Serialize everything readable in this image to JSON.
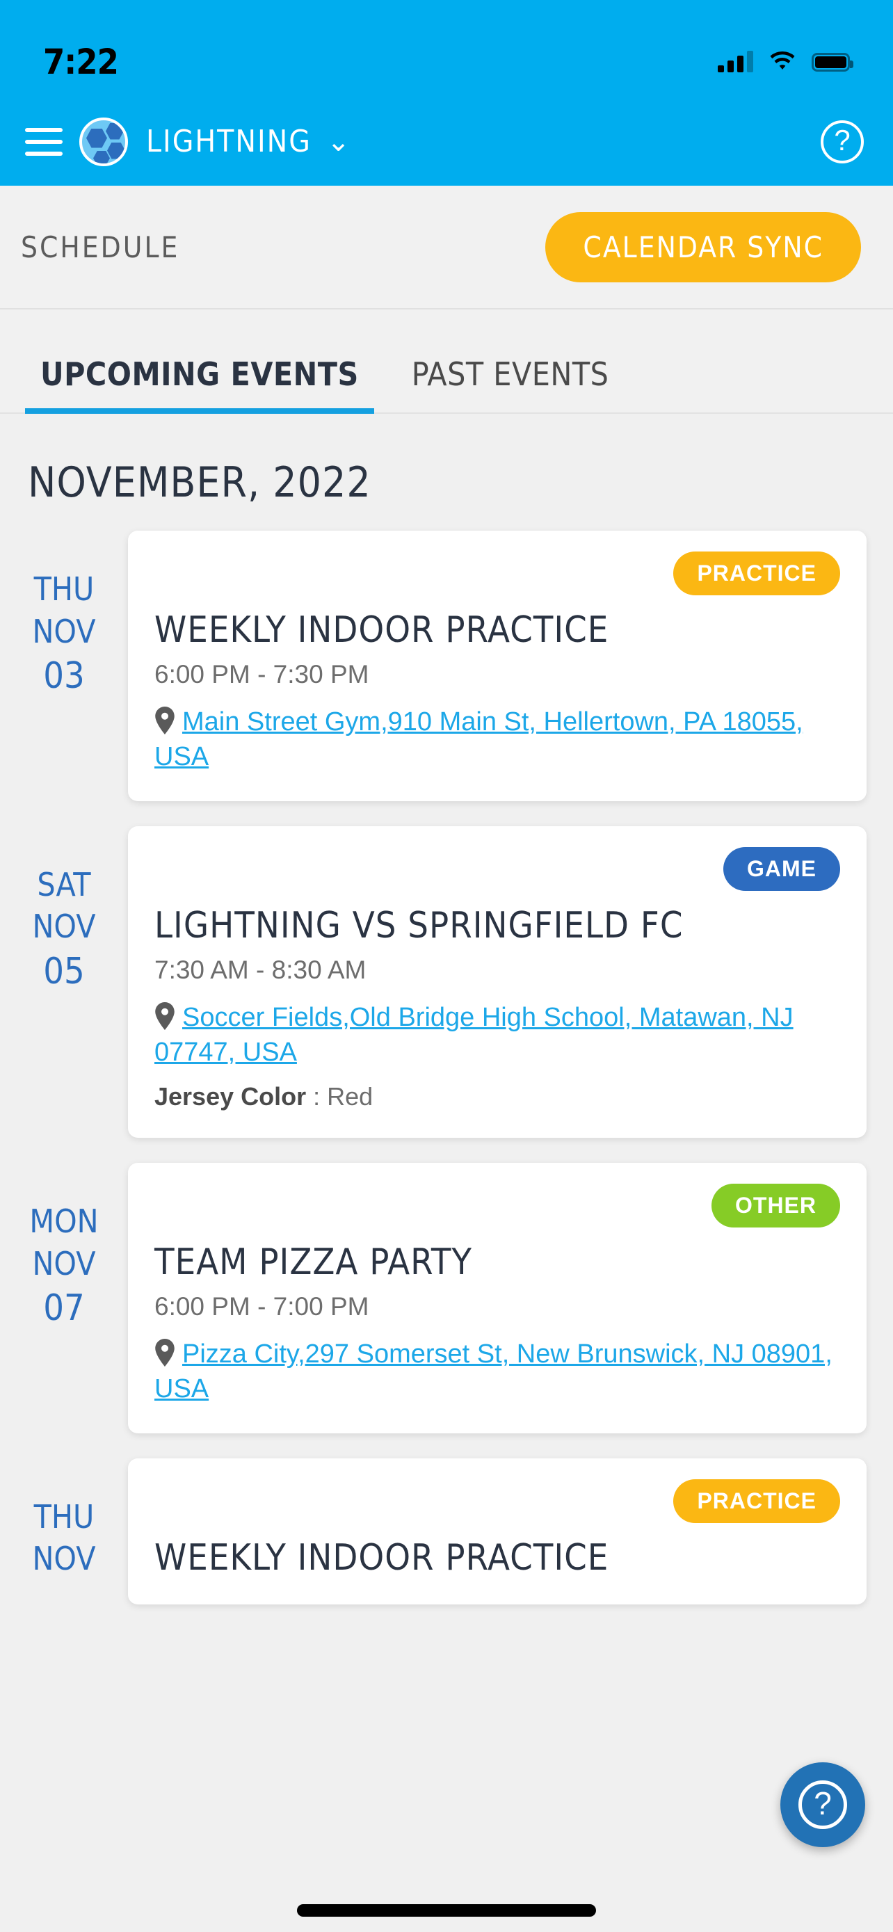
{
  "status_bar": {
    "time": "7:22",
    "signal_icon": "cellular-signal-icon",
    "wifi_icon": "wifi-icon",
    "battery_icon": "battery-icon"
  },
  "app_bar": {
    "menu_icon": "hamburger-menu-icon",
    "logo_icon": "soccer-ball-icon",
    "team_name": "LIGHTNING",
    "dropdown_icon": "chevron-down-icon",
    "help_icon": "help-circle-icon",
    "background_color": "#00ADEE"
  },
  "schedule_header": {
    "title": "SCHEDULE",
    "sync_button": "CALENDAR SYNC",
    "sync_button_color": "#FBB713"
  },
  "tabs": [
    {
      "label": "UPCOMING EVENTS",
      "active": true
    },
    {
      "label": "PAST EVENTS",
      "active": false
    }
  ],
  "tab_indicator_color": "#14A0E0",
  "month_header": "NOVEMBER, 2022",
  "events": [
    {
      "dow": "THU",
      "month": "NOV",
      "day": "03",
      "badge": "PRACTICE",
      "badge_color": "#FBB713",
      "title": "WEEKLY INDOOR PRACTICE",
      "time": "6:00 PM - 7:30 PM",
      "location": "Main Street Gym,910 Main St, Hellertown, PA 18055, USA",
      "location_icon": "map-pin-icon"
    },
    {
      "dow": "SAT",
      "month": "NOV",
      "day": "05",
      "badge": "GAME",
      "badge_color": "#2D6CC0",
      "title": "LIGHTNING VS SPRINGFIELD FC",
      "time": "7:30 AM - 8:30 AM",
      "location": "Soccer Fields,Old Bridge High School, Matawan, NJ 07747, USA",
      "location_icon": "map-pin-icon",
      "jersey_label": "Jersey Color",
      "jersey_value": ": Red"
    },
    {
      "dow": "MON",
      "month": "NOV",
      "day": "07",
      "badge": "OTHER",
      "badge_color": "#86CC26",
      "title": "TEAM PIZZA PARTY",
      "time": "6:00 PM - 7:00 PM",
      "location": "Pizza City,297 Somerset St, New Brunswick, NJ 08901, USA",
      "location_icon": "map-pin-icon"
    },
    {
      "dow": "THU",
      "month": "NOV",
      "day": "",
      "badge": "PRACTICE",
      "badge_color": "#FBB713",
      "title": "WEEKLY INDOOR PRACTICE",
      "time": "",
      "location": "",
      "location_icon": "map-pin-icon"
    }
  ],
  "fab": {
    "icon": "help-circle-icon",
    "color": "#2272B5"
  },
  "colors": {
    "date_blue": "#2C6DBD",
    "link_blue": "#1CA7E8",
    "page_bg": "#f0f0f0"
  }
}
